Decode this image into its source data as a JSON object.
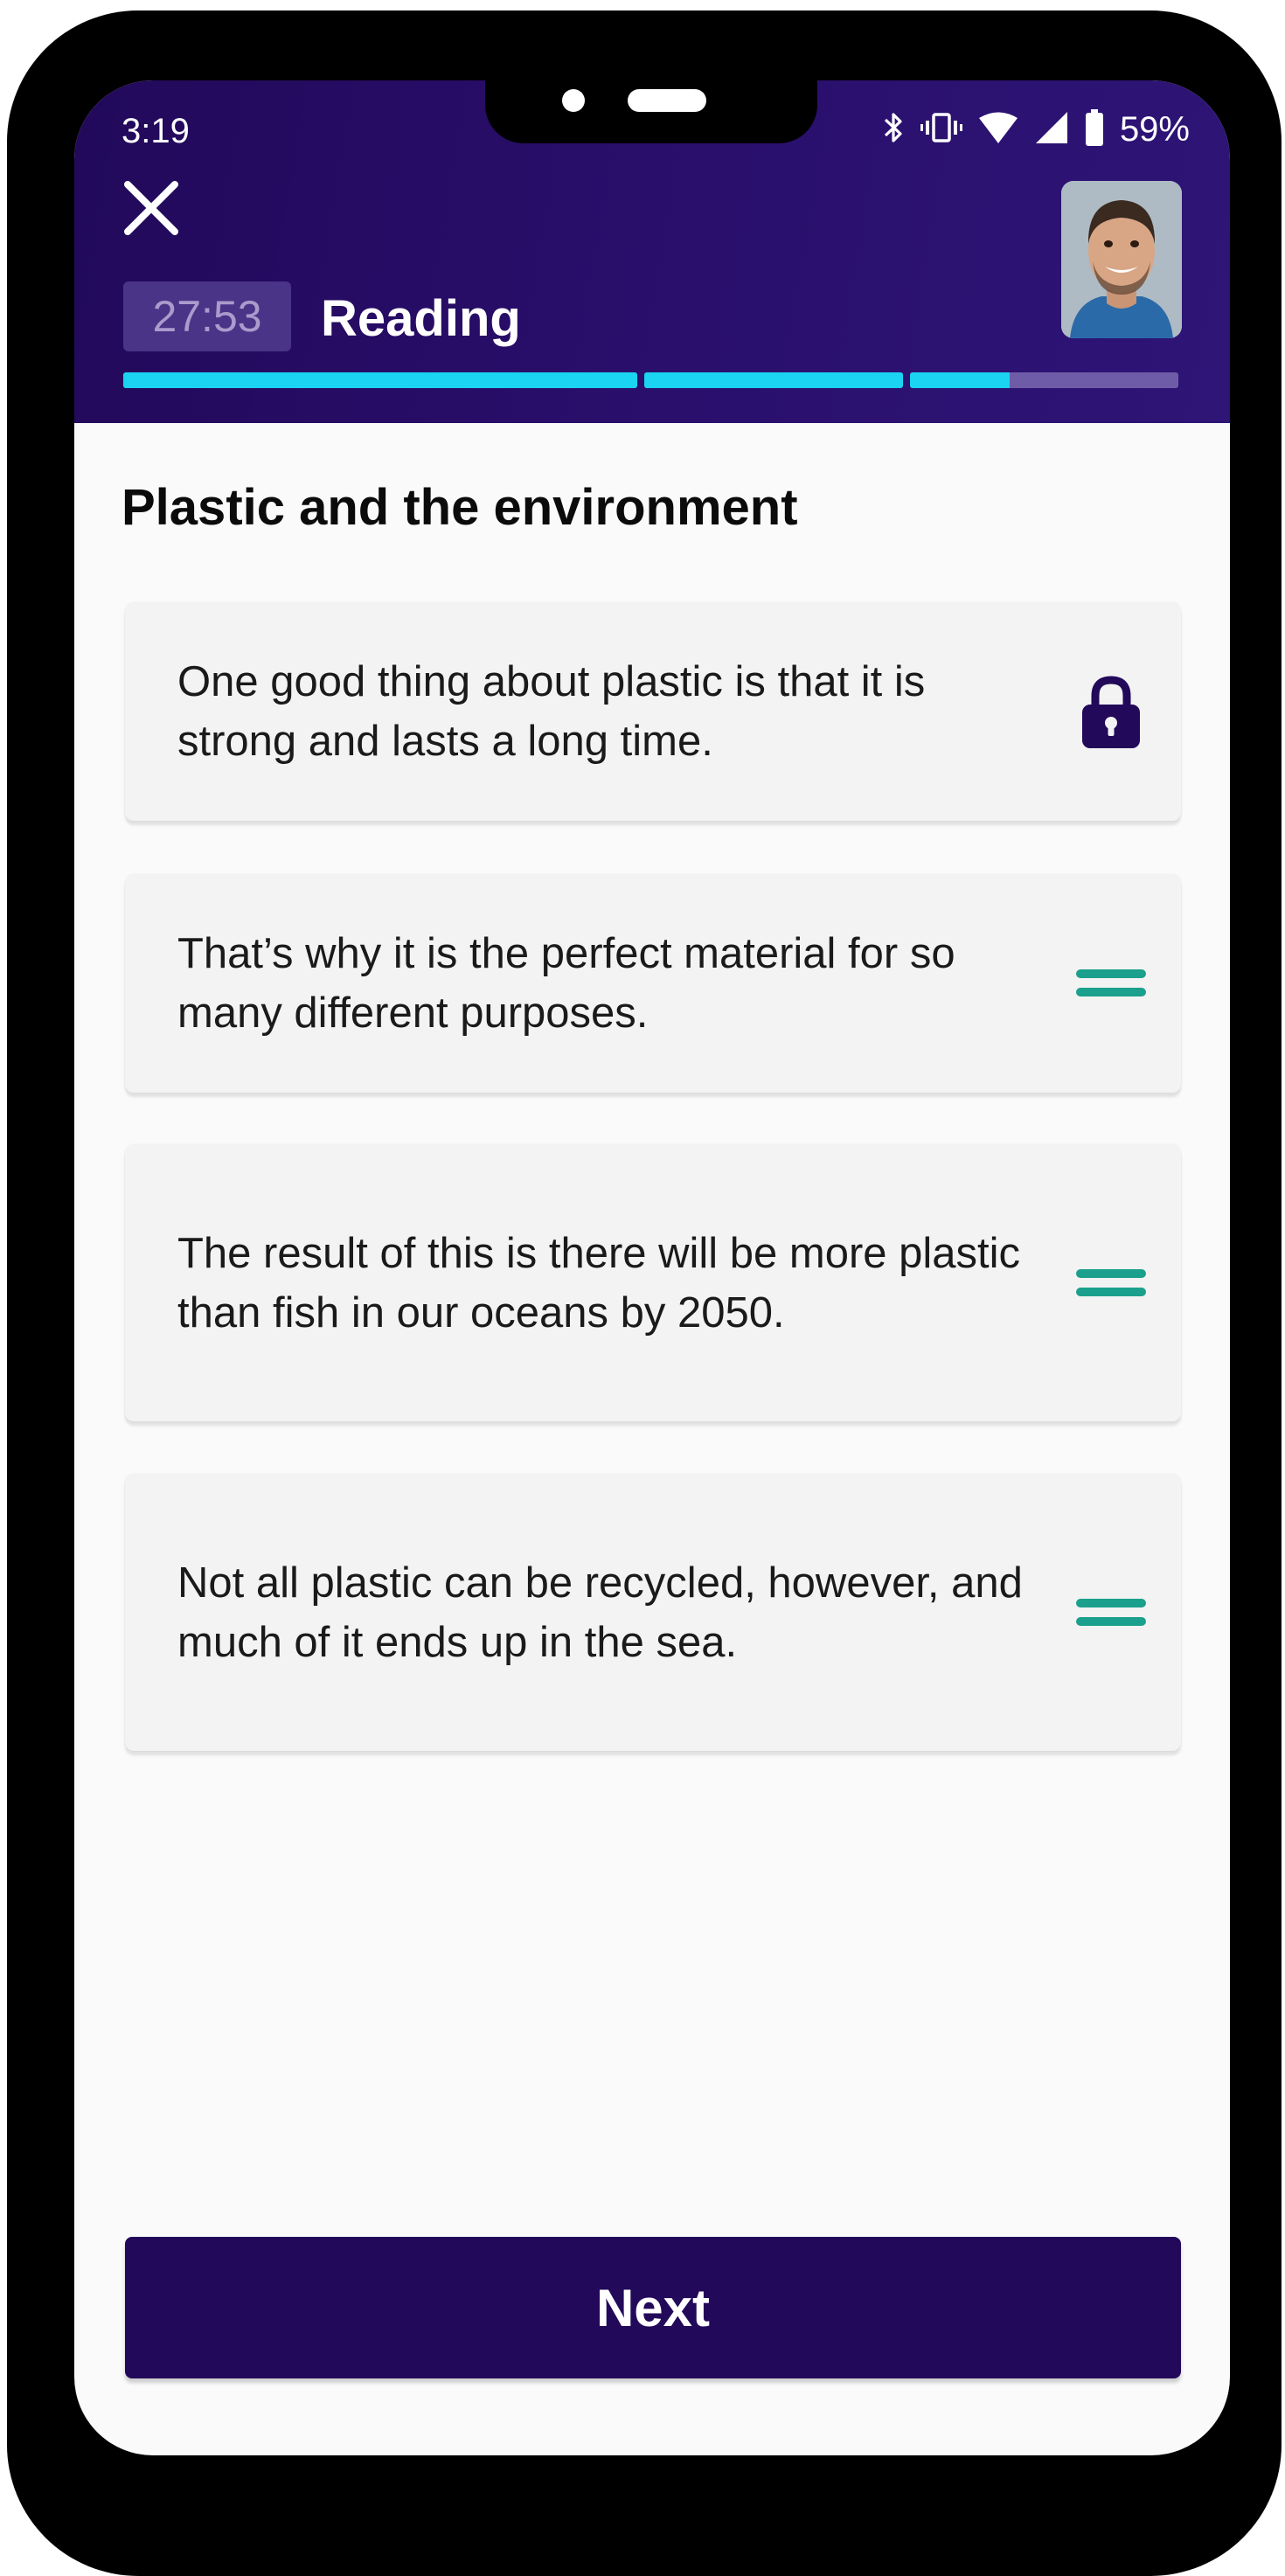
{
  "status_bar": {
    "time": "3:19",
    "battery_percent": "59%",
    "icons": [
      "bluetooth-icon",
      "vibrate-icon",
      "wifi-icon",
      "cell-signal-icon",
      "battery-icon"
    ]
  },
  "header": {
    "close_icon": "close-icon",
    "timer": "27:53",
    "section": "Reading",
    "avatar_icon": "user-avatar",
    "progress_segments": [
      {
        "fill": 1.0
      },
      {
        "fill": 1.0
      },
      {
        "fill": 0.37
      }
    ]
  },
  "main": {
    "title": "Plastic and the environment",
    "cards": [
      {
        "text": "One good thing about plastic is that it is strong and lasts a long time.",
        "handle": "lock-icon",
        "locked": true
      },
      {
        "text": "That’s why it is the perfect material for so many different purposes.",
        "handle": "drag-handle-icon",
        "locked": false
      },
      {
        "text": "The result of this is there will be more plastic than fish in our oceans by 2050.",
        "handle": "drag-handle-icon",
        "locked": false
      },
      {
        "text": "Not all plastic can be recycled, however, and much of it ends up in the sea.",
        "handle": "drag-handle-icon",
        "locked": false
      }
    ]
  },
  "footer": {
    "next_label": "Next"
  },
  "colors": {
    "header_bg": "#22095a",
    "progress_fill": "#1ad4f2",
    "progress_track": "#6f5ca8",
    "handle": "#1aa08c",
    "lock": "#22095a",
    "button_bg": "#22095a"
  }
}
